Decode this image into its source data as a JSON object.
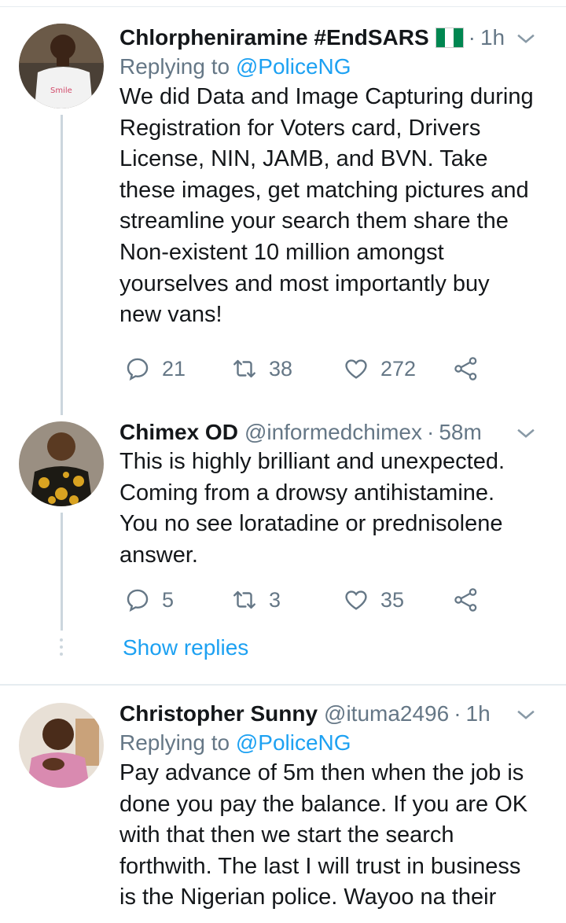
{
  "tweets": [
    {
      "name": "Chlorpheniramine #EndSARS",
      "handle": "",
      "time": "1h",
      "replying_prefix": "Replying to",
      "replying_to": "@PoliceNG",
      "lines": [
        "We did Data and Image Capturing during",
        "Registration for Voters card, Drivers",
        "License, NIN, JAMB, and BVN. Take",
        "these images, get matching pictures and",
        "streamline your search them share the",
        "Non-existent 10 million amongst",
        "yourselves and most importantly buy",
        "new vans!"
      ],
      "replies": "21",
      "retweets": "38",
      "likes": "272"
    },
    {
      "name": "Chimex OD",
      "handle": "@informedchimex",
      "time": "58m",
      "lines": [
        "This is highly brilliant and unexpected.",
        "Coming from a drowsy antihistamine.",
        "You no see loratadine or prednisolene",
        "answer."
      ],
      "replies": "5",
      "retweets": "3",
      "likes": "35"
    },
    {
      "name": "Christopher Sunny",
      "handle": "@ituma2496",
      "time": "1h",
      "replying_prefix": "Replying to",
      "replying_to": "@PoliceNG",
      "lines": [
        "Pay advance of 5m then when the job is",
        "done you pay the balance. If you are OK",
        "with that then we start the search",
        "forthwith. The last I will trust in business",
        "is the Nigerian police. Wayoo na their"
      ]
    }
  ],
  "show_replies": "Show replies",
  "dot_separator": "·",
  "colors": {
    "link": "#1da1f2",
    "muted": "#657786",
    "flag_green": "#008751",
    "flag_white": "#ffffff"
  },
  "icons": [
    "reply-icon",
    "retweet-icon",
    "like-icon",
    "share-icon",
    "chevron-down-icon",
    "nigeria-flag-icon"
  ]
}
